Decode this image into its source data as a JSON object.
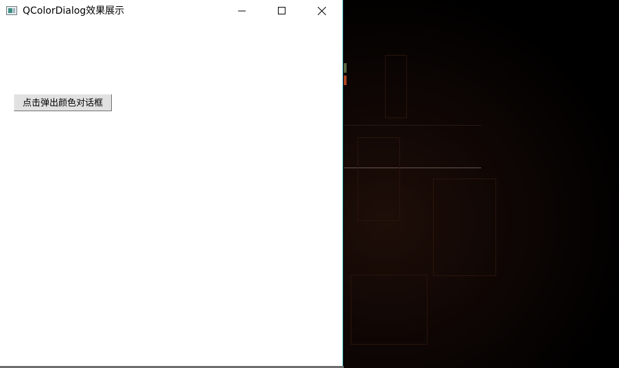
{
  "window": {
    "title": "QColorDialog效果展示",
    "minimize_glyph": "—",
    "maximize_glyph": "☐",
    "close_glyph": "✕"
  },
  "main": {
    "open_dialog_button_label": "点击弹出颜色对话框"
  },
  "icons": {
    "app": "app-window-icon",
    "minimize": "minimize-icon",
    "maximize": "maximize-icon",
    "close": "close-icon"
  },
  "colors": {
    "window_bg": "#ffffff",
    "window_border": "#4fb6c6",
    "button_bg": "#e1e1e1",
    "desktop_bg": "#000000"
  }
}
